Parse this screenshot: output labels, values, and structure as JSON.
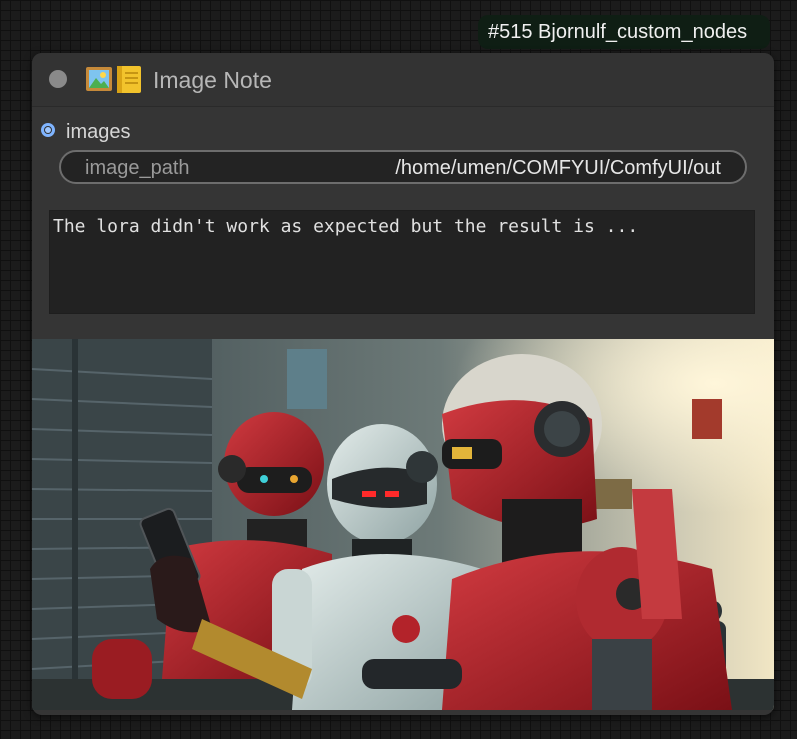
{
  "node": {
    "id_badge": "#515 Bjornulf_custom_nodes",
    "title": "Image Note",
    "title_icons": [
      "framed-picture-emoji",
      "ledger-emoji"
    ],
    "output": {
      "label": "images",
      "color": "#7fb4ff"
    },
    "image_path_widget": {
      "name": "image_path",
      "value": "/home/umen/COMFYUI/ComfyUI/out"
    },
    "note_text": "The lora didn't work as expected but the result is ...",
    "preview_image": {
      "subject": "three humanoid robots in a city street, one holding a smartphone"
    }
  },
  "colors": {
    "canvas_bg": "#1b1b1b",
    "node_bg": "#353535",
    "badge_bg": "#0f1e14",
    "robot_red": "#b0202a",
    "robot_white": "#c8d6d6"
  }
}
